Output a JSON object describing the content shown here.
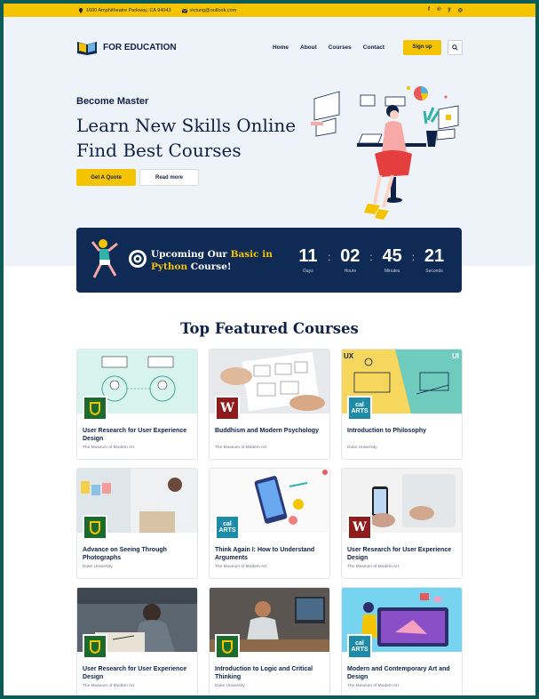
{
  "topbar": {
    "address": "1600 Amphitheatre Parkway, CA 94043",
    "email": "victung@outlook.com",
    "social": [
      "f",
      "℗",
      "y",
      "◎"
    ]
  },
  "nav": {
    "brand": "FOR EDUCATION",
    "links": [
      "Home",
      "About",
      "Courses",
      "Contact"
    ],
    "signup": "Sign up"
  },
  "hero": {
    "subtitle": "Become Master",
    "title_line1": "Learn New Skills Online",
    "title_line2": "Find Best Courses",
    "quote_btn": "Get A Quote",
    "read_btn": "Read more"
  },
  "countdown": {
    "text_a": "Upcoming Our ",
    "highlight": "Basic in Python",
    "text_b": " Course!",
    "days": "11",
    "days_label": "Days",
    "hours": "02",
    "hours_label": "Hours",
    "minutes": "45",
    "minutes_label": "Minutes",
    "seconds": "21",
    "seconds_label": "Seconds"
  },
  "courses_title": "Top Featured Courses",
  "courses": [
    {
      "title": "User Research for User Experience Design",
      "provider": "The Museum of Modern Art",
      "badge": "green",
      "thumb": "uxweb"
    },
    {
      "title": "Buddhism and Modern Psychology",
      "provider": "The Museum of Modern Art",
      "badge": "maroon",
      "thumb": "sketch"
    },
    {
      "title": "Introduction to Philosophy",
      "provider": "Duke University",
      "badge": "calarts",
      "thumb": "uxui"
    },
    {
      "title": "Advance on Seeing Through Photographs",
      "provider": "Duke University",
      "badge": "green",
      "thumb": "office"
    },
    {
      "title": "Think Again I: How to Understand Arguments",
      "provider": "The Museum of Modern Art",
      "badge": "calarts",
      "thumb": "phone"
    },
    {
      "title": "User Research for User Experience Design",
      "provider": "The Museum of Modern Art",
      "badge": "maroon",
      "thumb": "hands"
    },
    {
      "title": "User Research for User Experience Design",
      "provider": "The Museum of Modern Art",
      "badge": "green",
      "thumb": "drawing"
    },
    {
      "title": "Introduction to Logic and Critical Thinking",
      "provider": "Duke University",
      "badge": "green",
      "thumb": "desk"
    },
    {
      "title": "Modern and Contemporary Art and Design",
      "provider": "The Museum of Modern Art",
      "badge": "calarts",
      "thumb": "illus"
    }
  ],
  "badges": {
    "maroon": "W",
    "calarts_1": "cal",
    "calarts_2": "ARTS"
  },
  "colors": {
    "accent": "#f5c400",
    "navy": "#0f2a54",
    "hero_bg": "#eef3f9",
    "frame": "#0d5a56"
  }
}
